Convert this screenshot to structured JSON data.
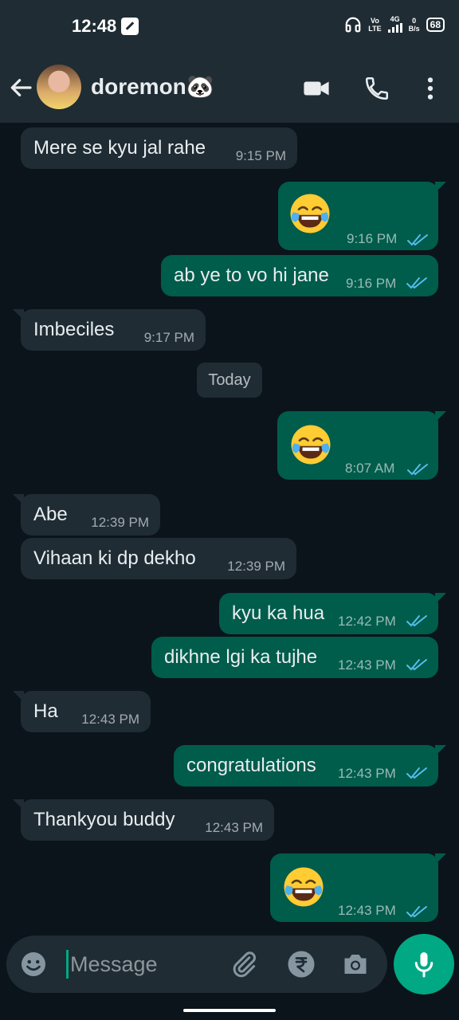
{
  "status_bar": {
    "time": "12:48",
    "net_top": "Vo",
    "net_bottom": "LTE",
    "net_gen": "4G",
    "speed_top": "0",
    "speed_bottom": "B/s",
    "battery": "68"
  },
  "header": {
    "contact_name": "doremon🐼"
  },
  "date_chip": "Today",
  "messages": [
    {
      "dir": "in",
      "text": "Mere se kyu jal rahe",
      "time": "9:15 PM"
    },
    {
      "dir": "out",
      "emoji": "😂",
      "time": "9:16 PM"
    },
    {
      "dir": "out",
      "text": "ab ye to vo hi jane",
      "time": "9:16 PM"
    },
    {
      "dir": "in",
      "text": "Imbeciles",
      "time": "9:17 PM"
    },
    {
      "dir": "out",
      "emoji": "😂",
      "time": "8:07 AM"
    },
    {
      "dir": "in",
      "text": "Abe",
      "time": "12:39 PM"
    },
    {
      "dir": "in",
      "text": "Vihaan ki dp dekho",
      "time": "12:39 PM"
    },
    {
      "dir": "out",
      "text": "kyu ka hua",
      "time": "12:42 PM"
    },
    {
      "dir": "out",
      "text": "dikhne lgi ka tujhe",
      "time": "12:43 PM"
    },
    {
      "dir": "in",
      "text": "Ha",
      "time": "12:43 PM"
    },
    {
      "dir": "out",
      "text": "congratulations",
      "time": "12:43 PM"
    },
    {
      "dir": "in",
      "text": "Thankyou buddy",
      "time": "12:43 PM"
    },
    {
      "dir": "out",
      "emoji": "😂",
      "time": "12:43 PM"
    }
  ],
  "composer": {
    "placeholder": "Message"
  },
  "icons": {
    "back": "arrow-back-icon",
    "video": "video-call-icon",
    "call": "phone-icon",
    "menu": "more-vert-icon",
    "emoji": "emoji-icon",
    "attach": "paperclip-icon",
    "payment": "rupee-icon",
    "camera": "camera-icon",
    "mic": "mic-icon",
    "read": "double-check-icon"
  },
  "colors": {
    "background": "#0b141a",
    "bar": "#1f2c34",
    "incoming": "#1f2c34",
    "outgoing": "#005c4b",
    "accent": "#00a884",
    "read_ticks": "#53bdeb"
  }
}
